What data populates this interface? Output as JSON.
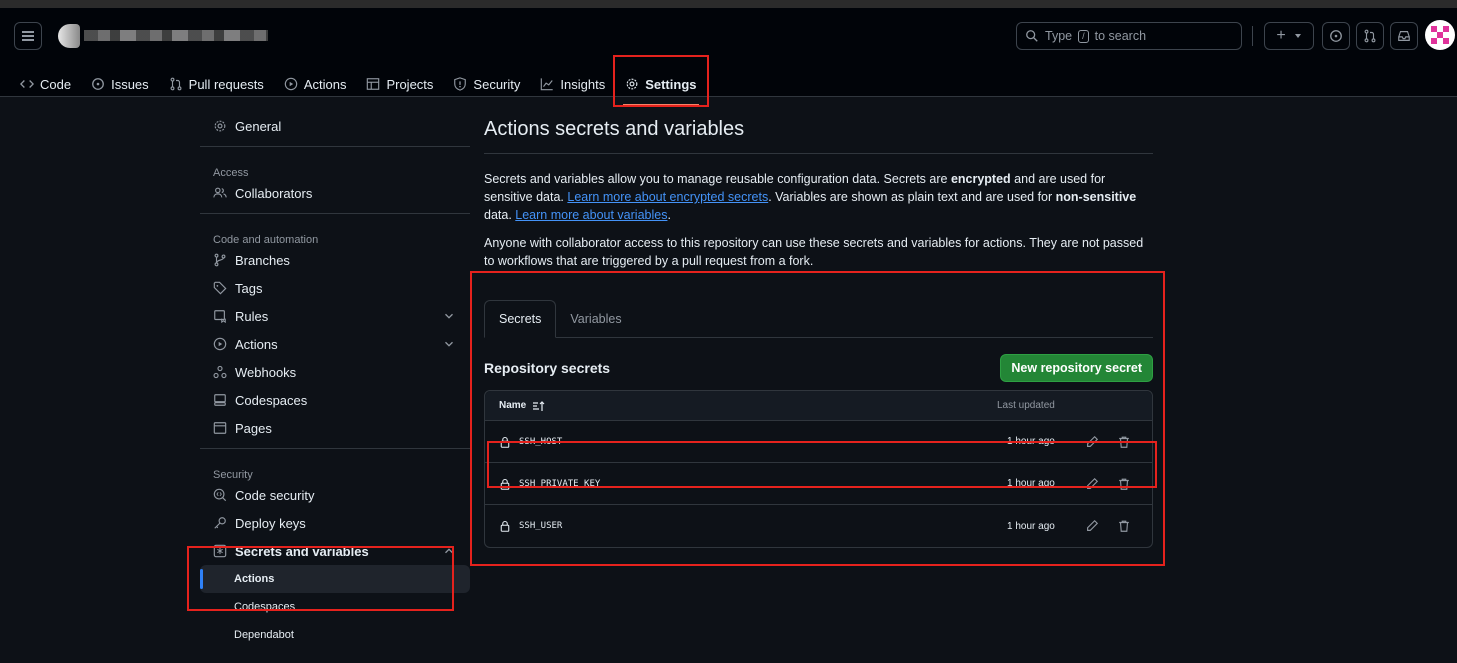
{
  "header": {
    "search": {
      "before": "Type",
      "key": "/",
      "after": "to search"
    },
    "plus": "+"
  },
  "repo_nav": {
    "tabs": [
      {
        "label": "Code",
        "icon": "code-icon"
      },
      {
        "label": "Issues",
        "icon": "issue-icon"
      },
      {
        "label": "Pull requests",
        "icon": "pull-request-icon"
      },
      {
        "label": "Actions",
        "icon": "play-icon"
      },
      {
        "label": "Projects",
        "icon": "table-icon"
      },
      {
        "label": "Security",
        "icon": "shield-icon"
      },
      {
        "label": "Insights",
        "icon": "graph-icon"
      },
      {
        "label": "Settings",
        "icon": "gear-icon",
        "active": true
      }
    ]
  },
  "sidebar": {
    "general": "General",
    "access_heading": "Access",
    "collaborators": "Collaborators",
    "code_heading": "Code and automation",
    "branches": "Branches",
    "tags": "Tags",
    "rules": "Rules",
    "actions": "Actions",
    "webhooks": "Webhooks",
    "codespaces": "Codespaces",
    "pages": "Pages",
    "security_heading": "Security",
    "code_security": "Code security",
    "deploy_keys": "Deploy keys",
    "secrets_vars": "Secrets and variables",
    "sub_actions": "Actions",
    "sub_codespaces": "Codespaces",
    "sub_dependabot": "Dependabot"
  },
  "main": {
    "title": "Actions secrets and variables",
    "p1_a": "Secrets and variables allow you to manage reusable configuration data. Secrets are ",
    "p1_b": "encrypted",
    "p1_c": " and are used for sensitive data. ",
    "p1_link1": "Learn more about encrypted secrets",
    "p1_d": ". Variables are shown as plain text and are used for ",
    "p1_e": "non-sensitive",
    "p1_f": " data. ",
    "p1_link2": "Learn more about variables",
    "p1_g": ".",
    "p2": "Anyone with collaborator access to this repository can use these secrets and variables for actions. They are not passed to workflows that are triggered by a pull request from a fork.",
    "tabs": [
      "Secrets",
      "Variables"
    ],
    "section_title": "Repository secrets",
    "new_button": "New repository secret",
    "table": {
      "col_name": "Name",
      "col_updated": "Last updated",
      "rows": [
        {
          "name": "SSH_HOST",
          "updated": "1 hour ago"
        },
        {
          "name": "SSH_PRIVATE_KEY",
          "updated": "1 hour ago"
        },
        {
          "name": "SSH_USER",
          "updated": "1 hour ago"
        }
      ]
    }
  },
  "colors": {
    "accent_green": "#238636",
    "link": "#4493f8",
    "annotation_red": "#e5221d"
  }
}
